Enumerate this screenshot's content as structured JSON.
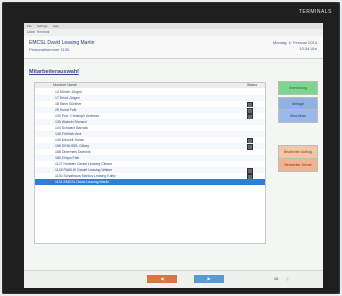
{
  "brand": "TERMINALS",
  "menu": [
    "File",
    "Settings",
    "Help"
  ],
  "window_title": "Datei  Terminal",
  "header": {
    "user": "EMCSL David Leasing Martin",
    "sub": "Personalnummer 1130",
    "date": "Montag, 4. Februar 2013",
    "time": "10:34 Uhr"
  },
  "page_title": "Mitarbeiterauswahl",
  "list": {
    "col_name": "Nummer Name",
    "col_status": "Status",
    "rows": [
      {
        "name": "14 Münch Jürgen"
      },
      {
        "name": "17 Ernst Jürgen"
      },
      {
        "name": "18 Stein Günther"
      },
      {
        "name": "25 Kunal Falk"
      },
      {
        "name": "100 Prof. Christoph Andreas"
      },
      {
        "name": "130 Wabeln Richard"
      },
      {
        "name": "144 Schwarz Barrata"
      },
      {
        "name": "145 Fröhlich Aria"
      },
      {
        "name": "149 Künzell Jonas"
      },
      {
        "name": "158 DENHSEL Gilbay"
      },
      {
        "name": "158 Obermeis Dominik"
      },
      {
        "name": "180 Zimpa Falk"
      },
      {
        "name": "1127 Holstein Daniel Leasing Cleven"
      },
      {
        "name": "1128 PAWLIK Daniel Leasing Walker"
      },
      {
        "name": "1130 Schallhaus Markus Leasing Kaltiz"
      },
      {
        "name": "1131 EMCSL David Leasing Martin"
      }
    ]
  },
  "actions": {
    "anmeldung": "Anmeldung",
    "dienst": "Anfrage",
    "wechsel": "Abschluss",
    "auftrag": "Bearbeiter Auftrag",
    "dienst2": "Bearbeiter Dienst"
  },
  "footer": {
    "prev": "◀",
    "next": "▶"
  }
}
